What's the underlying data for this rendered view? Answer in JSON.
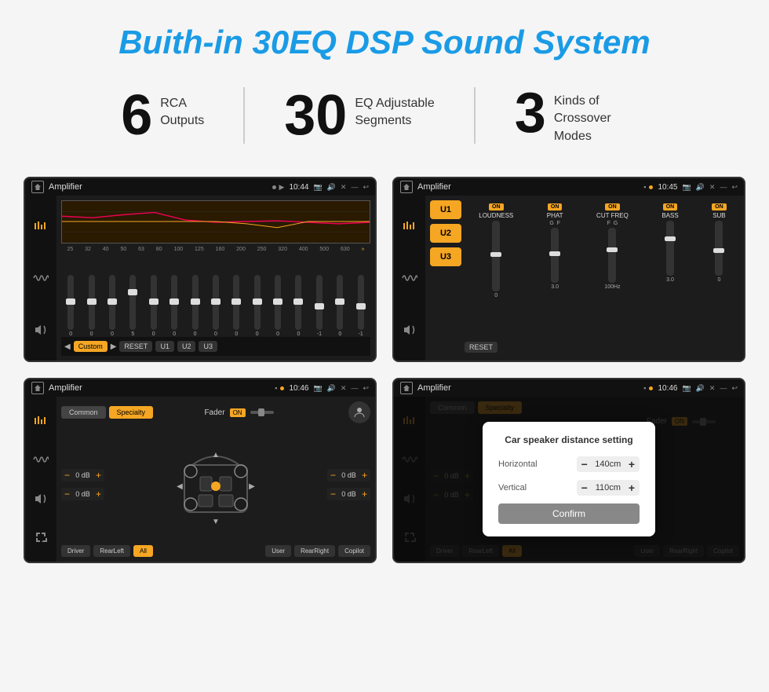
{
  "page": {
    "title": "Buith-in 30EQ DSP Sound System",
    "stats": [
      {
        "number": "6",
        "label_line1": "RCA",
        "label_line2": "Outputs"
      },
      {
        "number": "30",
        "label_line1": "EQ Adjustable",
        "label_line2": "Segments"
      },
      {
        "number": "3",
        "label_line1": "Kinds of",
        "label_line2": "Crossover Modes"
      }
    ]
  },
  "screens": {
    "screen1": {
      "title": "Amplifier",
      "time": "10:44",
      "eq_labels": [
        "25",
        "32",
        "40",
        "50",
        "63",
        "80",
        "100",
        "125",
        "160",
        "200",
        "250",
        "320",
        "400",
        "500",
        "630"
      ],
      "eq_values": [
        "0",
        "0",
        "0",
        "5",
        "0",
        "0",
        "0",
        "0",
        "0",
        "0",
        "0",
        "0",
        "-1",
        "0",
        "-1"
      ],
      "presets": [
        "Custom",
        "RESET",
        "U1",
        "U2",
        "U3"
      ]
    },
    "screen2": {
      "title": "Amplifier",
      "time": "10:45",
      "presets": [
        "U1",
        "U2",
        "U3"
      ],
      "channels": [
        "LOUDNESS",
        "PHAT",
        "CUT FREQ",
        "BASS",
        "SUB"
      ],
      "reset_label": "RESET"
    },
    "screen3": {
      "title": "Amplifier",
      "time": "10:46",
      "tabs": [
        "Common",
        "Specialty"
      ],
      "fader_label": "Fader",
      "fader_on": "ON",
      "db_values": [
        "0 dB",
        "0 dB",
        "0 dB",
        "0 dB"
      ],
      "bottom_btns": [
        "Driver",
        "RearLeft",
        "All",
        "User",
        "RearRight",
        "Copilot"
      ]
    },
    "screen4": {
      "title": "Amplifier",
      "time": "10:46",
      "tabs": [
        "Common",
        "Specialty"
      ],
      "dialog": {
        "title": "Car speaker distance setting",
        "horizontal_label": "Horizontal",
        "horizontal_value": "140cm",
        "vertical_label": "Vertical",
        "vertical_value": "110cm",
        "confirm_label": "Confirm"
      },
      "db_values": [
        "0 dB",
        "0 dB"
      ],
      "bottom_btns": [
        "Driver",
        "RearLeft",
        "All",
        "User",
        "RearRight",
        "Copilot"
      ]
    }
  }
}
